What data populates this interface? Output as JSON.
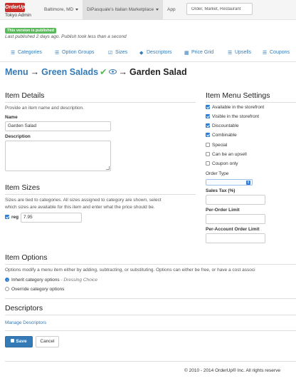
{
  "header": {
    "logo_text": "OrderUp",
    "admin_label": "Tokyo Admin",
    "market": "Baltimore, MD",
    "restaurant": "DiPasquale's Italian Marketplace",
    "app_label": "App",
    "search_placeholder": "Order, Market, Restaurant"
  },
  "status": {
    "badge": "This version is published",
    "note": "Last published 2 days ago. Publish took less than a second"
  },
  "tabs": [
    {
      "label": "Categories",
      "icon": "list-icon"
    },
    {
      "label": "Option Groups",
      "icon": "list-icon"
    },
    {
      "label": "Sizes",
      "icon": "check-square-icon"
    },
    {
      "label": "Descriptors",
      "icon": "tag-icon"
    },
    {
      "label": "Price Grid",
      "icon": "grid-icon"
    },
    {
      "label": "Upsells",
      "icon": "list-icon"
    },
    {
      "label": "Coupons",
      "icon": "list-icon"
    }
  ],
  "breadcrumb": {
    "root": "Menu",
    "category": "Green Salads",
    "item": "Garden Salad",
    "arrow": "→"
  },
  "item_details": {
    "title": "Item Details",
    "help": "Provide an item name and description.",
    "name_label": "Name",
    "name_value": "Garden Salad",
    "description_label": "Description",
    "description_value": ""
  },
  "item_sizes": {
    "title": "Item Sizes",
    "help_line1": "Sizes are tied to categories. All sizes assigned to category are shown, select",
    "help_line2": "which sizes are available for this item and enter what the price should be.",
    "size_label": "reg",
    "size_checked": true,
    "price_value": "7.95"
  },
  "item_menu_settings": {
    "title": "Item Menu Settings",
    "checkboxes": [
      {
        "label": "Available in the storefront",
        "checked": true
      },
      {
        "label": "Visible in the storefront",
        "checked": true
      },
      {
        "label": "Discountable",
        "checked": true
      },
      {
        "label": "Combinable",
        "checked": true
      },
      {
        "label": "Special",
        "checked": false
      },
      {
        "label": "Can be an upsell",
        "checked": false
      },
      {
        "label": "Coupon only",
        "checked": false
      }
    ],
    "order_type_label": "Order Type",
    "order_type_value": "",
    "sales_tax_label": "Sales Tax (%)",
    "sales_tax_value": "",
    "per_order_limit_label": "Per-Order Limit",
    "per_order_limit_value": "",
    "per_account_limit_label": "Per-Account Order Limit",
    "per_account_limit_value": ""
  },
  "item_options": {
    "title": "Item Options",
    "help": "Options modify a menu item either by adding, subtracting, or substituting. Options can either be free, or have a cost associ",
    "inherit_label": "Inherit category options",
    "inherit_suffix": "- Dressing Choice",
    "inherit_selected": true,
    "override_label": "Override category options"
  },
  "descriptors": {
    "title": "Descriptors",
    "manage_link": "Manage Descriptors"
  },
  "actions": {
    "save_label": "Save",
    "cancel_label": "Cancel"
  },
  "footer": {
    "copyright": "© 2010 - 2014 OrderUp® Inc. All rights reserve"
  },
  "colors": {
    "link": "#337ab7",
    "success": "#5cb85c",
    "brand": "#c9302c"
  }
}
